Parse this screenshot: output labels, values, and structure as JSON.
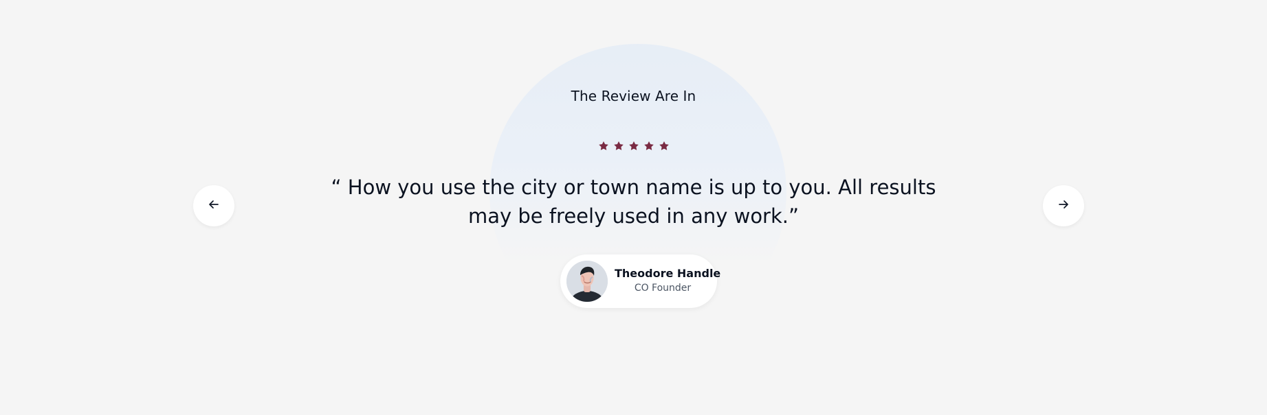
{
  "section": {
    "title": "The Review Are In"
  },
  "rating": {
    "value": 5,
    "max": 5,
    "star_color": "#7a2a43"
  },
  "testimonial": {
    "quote": "“ How you use the city or town name is up to you. All results may be freely used in any work.”"
  },
  "author": {
    "name": "Theodore Handle",
    "role": "CO Founder"
  },
  "controls": {
    "prev_icon": "arrow-left-icon",
    "next_icon": "arrow-right-icon"
  }
}
